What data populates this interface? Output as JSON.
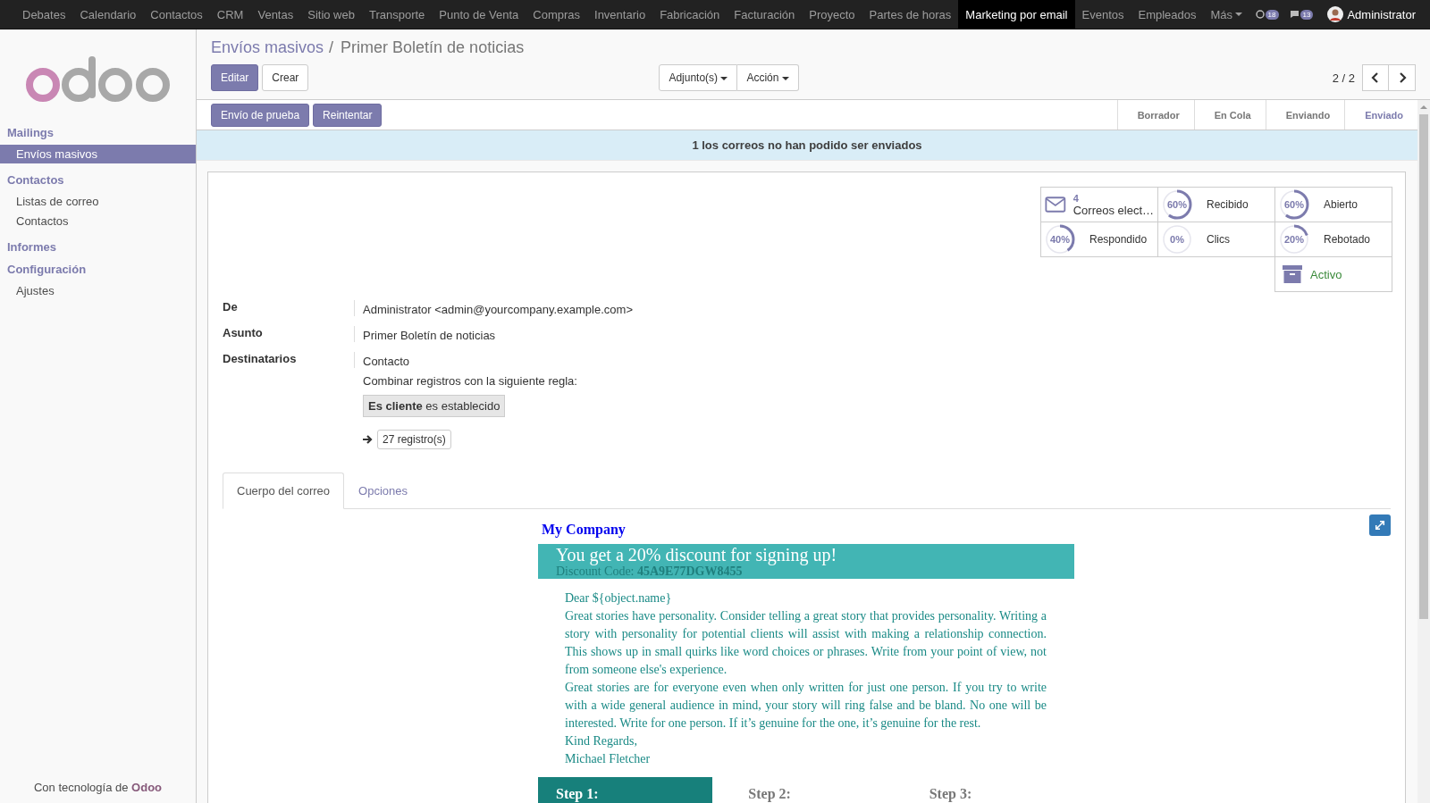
{
  "top_menu": {
    "items": [
      {
        "label": "Debates",
        "selected": false
      },
      {
        "label": "Calendario",
        "selected": false
      },
      {
        "label": "Contactos",
        "selected": false
      },
      {
        "label": "CRM",
        "selected": false
      },
      {
        "label": "Ventas",
        "selected": false
      },
      {
        "label": "Sitio web",
        "selected": false
      },
      {
        "label": "Transporte",
        "selected": false
      },
      {
        "label": "Punto de Venta",
        "selected": false
      },
      {
        "label": "Compras",
        "selected": false
      },
      {
        "label": "Inventario",
        "selected": false
      },
      {
        "label": "Fabricación",
        "selected": false
      },
      {
        "label": "Facturación",
        "selected": false
      },
      {
        "label": "Proyecto",
        "selected": false
      },
      {
        "label": "Partes de horas",
        "selected": false
      },
      {
        "label": "Marketing por email",
        "selected": true
      },
      {
        "label": "Eventos",
        "selected": false
      },
      {
        "label": "Empleados",
        "selected": false
      }
    ],
    "more": "Más",
    "notifications": [
      {
        "kind": "activity",
        "count": "18"
      },
      {
        "kind": "chat",
        "count": "13"
      }
    ],
    "user": "Administrator"
  },
  "sidebar": {
    "sections": [
      {
        "title": "Mailings",
        "items": [
          {
            "label": "Envíos masivos",
            "selected": true
          }
        ]
      },
      {
        "title": "Contactos",
        "items": [
          {
            "label": "Listas de correo",
            "selected": false
          },
          {
            "label": "Contactos",
            "selected": false
          }
        ]
      },
      {
        "title": "Informes"
      },
      {
        "title": "Configuración",
        "items": [
          {
            "label": "Ajustes",
            "selected": false
          }
        ]
      }
    ],
    "footer": {
      "text": "Con tecnología de",
      "brand": "Odoo"
    }
  },
  "breadcrumb": {
    "parent": "Envíos masivos",
    "separator": "/",
    "current": "Primer Boletín de noticias"
  },
  "buttons": [
    {
      "label": "Editar",
      "kind": "primary"
    },
    {
      "label": "Crear",
      "kind": "default"
    }
  ],
  "dropdowns": [
    "Adjunto(s)",
    "Acción"
  ],
  "pager": "2 / 2",
  "header_buttons": [
    "Envío de prueba",
    "Reintentar"
  ],
  "stages": [
    {
      "label": "Borrador",
      "selected": false
    },
    {
      "label": "En Cola",
      "selected": false
    },
    {
      "label": "Enviando",
      "selected": false
    },
    {
      "label": "Enviado",
      "selected": true
    }
  ],
  "alert": "1 los correos no han podido ser enviados",
  "stats": [
    {
      "kind": "count",
      "value": "4",
      "label": "Correos elect…"
    },
    {
      "kind": "ring",
      "value": "60%",
      "level": 0.6,
      "label": "Recibido"
    },
    {
      "kind": "ring",
      "value": "60%",
      "level": 0.6,
      "label": "Abierto"
    },
    {
      "kind": "ring",
      "value": "40%",
      "level": 0.4,
      "label": "Respondido"
    },
    {
      "kind": "ring",
      "value": "0%",
      "level": 0,
      "label": "Clics"
    },
    {
      "kind": "ring",
      "value": "20%",
      "level": 0.2,
      "label": "Rebotado"
    },
    {
      "kind": "archive",
      "label": "Activo"
    }
  ],
  "fields": [
    {
      "label": "De",
      "value": "Administrator <admin@yourcompany.example.com>"
    },
    {
      "label": "Asunto",
      "value": "Primer Boletín de noticias"
    },
    {
      "label": "Destinatarios",
      "value": "Contacto"
    }
  ],
  "domain": {
    "text": "Combinar registros con la siguiente regla:",
    "rule_field": "Es cliente",
    "rule_op": "es establecido",
    "records": "27 registro(s)"
  },
  "tabs": [
    {
      "label": "Cuerpo del correo",
      "selected": true
    },
    {
      "label": "Opciones",
      "selected": false
    }
  ],
  "email": {
    "company": "My Company",
    "banner_title": "You get a 20% discount for signing up!",
    "code_label": "Discount Code:",
    "code": "45A9E77DGW8455",
    "lines": [
      "Dear ${object.name}",
      "Great stories have personality. Consider telling a great story that provides personality. Writing a story with personality for potential clients will assist with making a relationship connection. This shows up in small quirks like word choices or phrases. Write from your point of view, not from someone else's experience.",
      "Great stories are for everyone even when only written for just one person. If you try to write with a wide general audience in mind, your story will ring false and be bland. No one will be interested. Write for one person. If it’s genuine for the one, it’s genuine for the rest.",
      "Kind Regards,",
      "Michael Fletcher"
    ],
    "steps": [
      {
        "label": "Step 1:",
        "highlighted": true
      },
      {
        "label": "Step 2:",
        "highlighted": false
      },
      {
        "label": "Step 3:",
        "highlighted": false
      }
    ]
  }
}
